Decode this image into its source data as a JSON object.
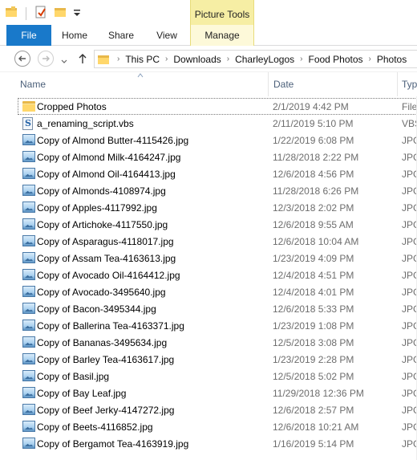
{
  "title_bar": {
    "qat_icons": [
      "folder-icon",
      "properties-icon",
      "new-folder-icon",
      "customize-dropdown-icon"
    ],
    "context_tab_group": "Picture Tools"
  },
  "ribbon": {
    "tabs": [
      {
        "label": "File",
        "active": true
      },
      {
        "label": "Home"
      },
      {
        "label": "Share"
      },
      {
        "label": "View"
      },
      {
        "label": "Manage"
      }
    ]
  },
  "address_bar": {
    "crumbs": [
      "This PC",
      "Downloads",
      "CharleyLogos",
      "Food Photos",
      "Photos"
    ]
  },
  "columns": {
    "name": "Name",
    "date": "Date",
    "type": "Typ"
  },
  "files": [
    {
      "name": "Cropped Photos",
      "date": "2/1/2019 4:42 PM",
      "type": "File",
      "icon": "folder-icon"
    },
    {
      "name": "a_renaming_script.vbs",
      "date": "2/11/2019 5:10 PM",
      "type": "VBS",
      "icon": "vbs-script-icon"
    },
    {
      "name": "Copy of Almond Butter-4115426.jpg",
      "date": "1/22/2019 6:08 PM",
      "type": "JPG",
      "icon": "jpg-image-icon"
    },
    {
      "name": "Copy of Almond Milk-4164247.jpg",
      "date": "11/28/2018 2:22 PM",
      "type": "JPG",
      "icon": "jpg-image-icon"
    },
    {
      "name": "Copy of Almond Oil-4164413.jpg",
      "date": "12/6/2018 4:56 PM",
      "type": "JPG",
      "icon": "jpg-image-icon"
    },
    {
      "name": "Copy of Almonds-4108974.jpg",
      "date": "11/28/2018 6:26 PM",
      "type": "JPG",
      "icon": "jpg-image-icon"
    },
    {
      "name": "Copy of Apples-4117992.jpg",
      "date": "12/3/2018 2:02 PM",
      "type": "JPG",
      "icon": "jpg-image-icon"
    },
    {
      "name": "Copy of Artichoke-4117550.jpg",
      "date": "12/6/2018 9:55 AM",
      "type": "JPG",
      "icon": "jpg-image-icon"
    },
    {
      "name": "Copy of Asparagus-4118017.jpg",
      "date": "12/6/2018 10:04 AM",
      "type": "JPG",
      "icon": "jpg-image-icon"
    },
    {
      "name": "Copy of Assam Tea-4163613.jpg",
      "date": "1/23/2019 4:09 PM",
      "type": "JPG",
      "icon": "jpg-image-icon"
    },
    {
      "name": "Copy of Avocado Oil-4164412.jpg",
      "date": "12/4/2018 4:51 PM",
      "type": "JPG",
      "icon": "jpg-image-icon"
    },
    {
      "name": "Copy of Avocado-3495640.jpg",
      "date": "12/4/2018 4:01 PM",
      "type": "JPG",
      "icon": "jpg-image-icon"
    },
    {
      "name": "Copy of Bacon-3495344.jpg",
      "date": "12/6/2018 5:33 PM",
      "type": "JPG",
      "icon": "jpg-image-icon"
    },
    {
      "name": "Copy of Ballerina Tea-4163371.jpg",
      "date": "1/23/2019 1:08 PM",
      "type": "JPG",
      "icon": "jpg-image-icon"
    },
    {
      "name": "Copy of Bananas-3495634.jpg",
      "date": "12/5/2018 3:08 PM",
      "type": "JPG",
      "icon": "jpg-image-icon"
    },
    {
      "name": "Copy of Barley Tea-4163617.jpg",
      "date": "1/23/2019 2:28 PM",
      "type": "JPG",
      "icon": "jpg-image-icon"
    },
    {
      "name": "Copy of Basil.jpg",
      "date": "12/5/2018 5:02 PM",
      "type": "JPG",
      "icon": "jpg-image-icon"
    },
    {
      "name": "Copy of Bay Leaf.jpg",
      "date": "11/29/2018 12:36 PM",
      "type": "JPG",
      "icon": "jpg-image-icon"
    },
    {
      "name": "Copy of Beef Jerky-4147272.jpg",
      "date": "12/6/2018 2:57 PM",
      "type": "JPG",
      "icon": "jpg-image-icon"
    },
    {
      "name": "Copy of Beets-4116852.jpg",
      "date": "12/6/2018 10:21 AM",
      "type": "JPG",
      "icon": "jpg-image-icon"
    },
    {
      "name": "Copy of Bergamot Tea-4163919.jpg",
      "date": "1/16/2019 5:14 PM",
      "type": "JPG",
      "icon": "jpg-image-icon"
    }
  ]
}
